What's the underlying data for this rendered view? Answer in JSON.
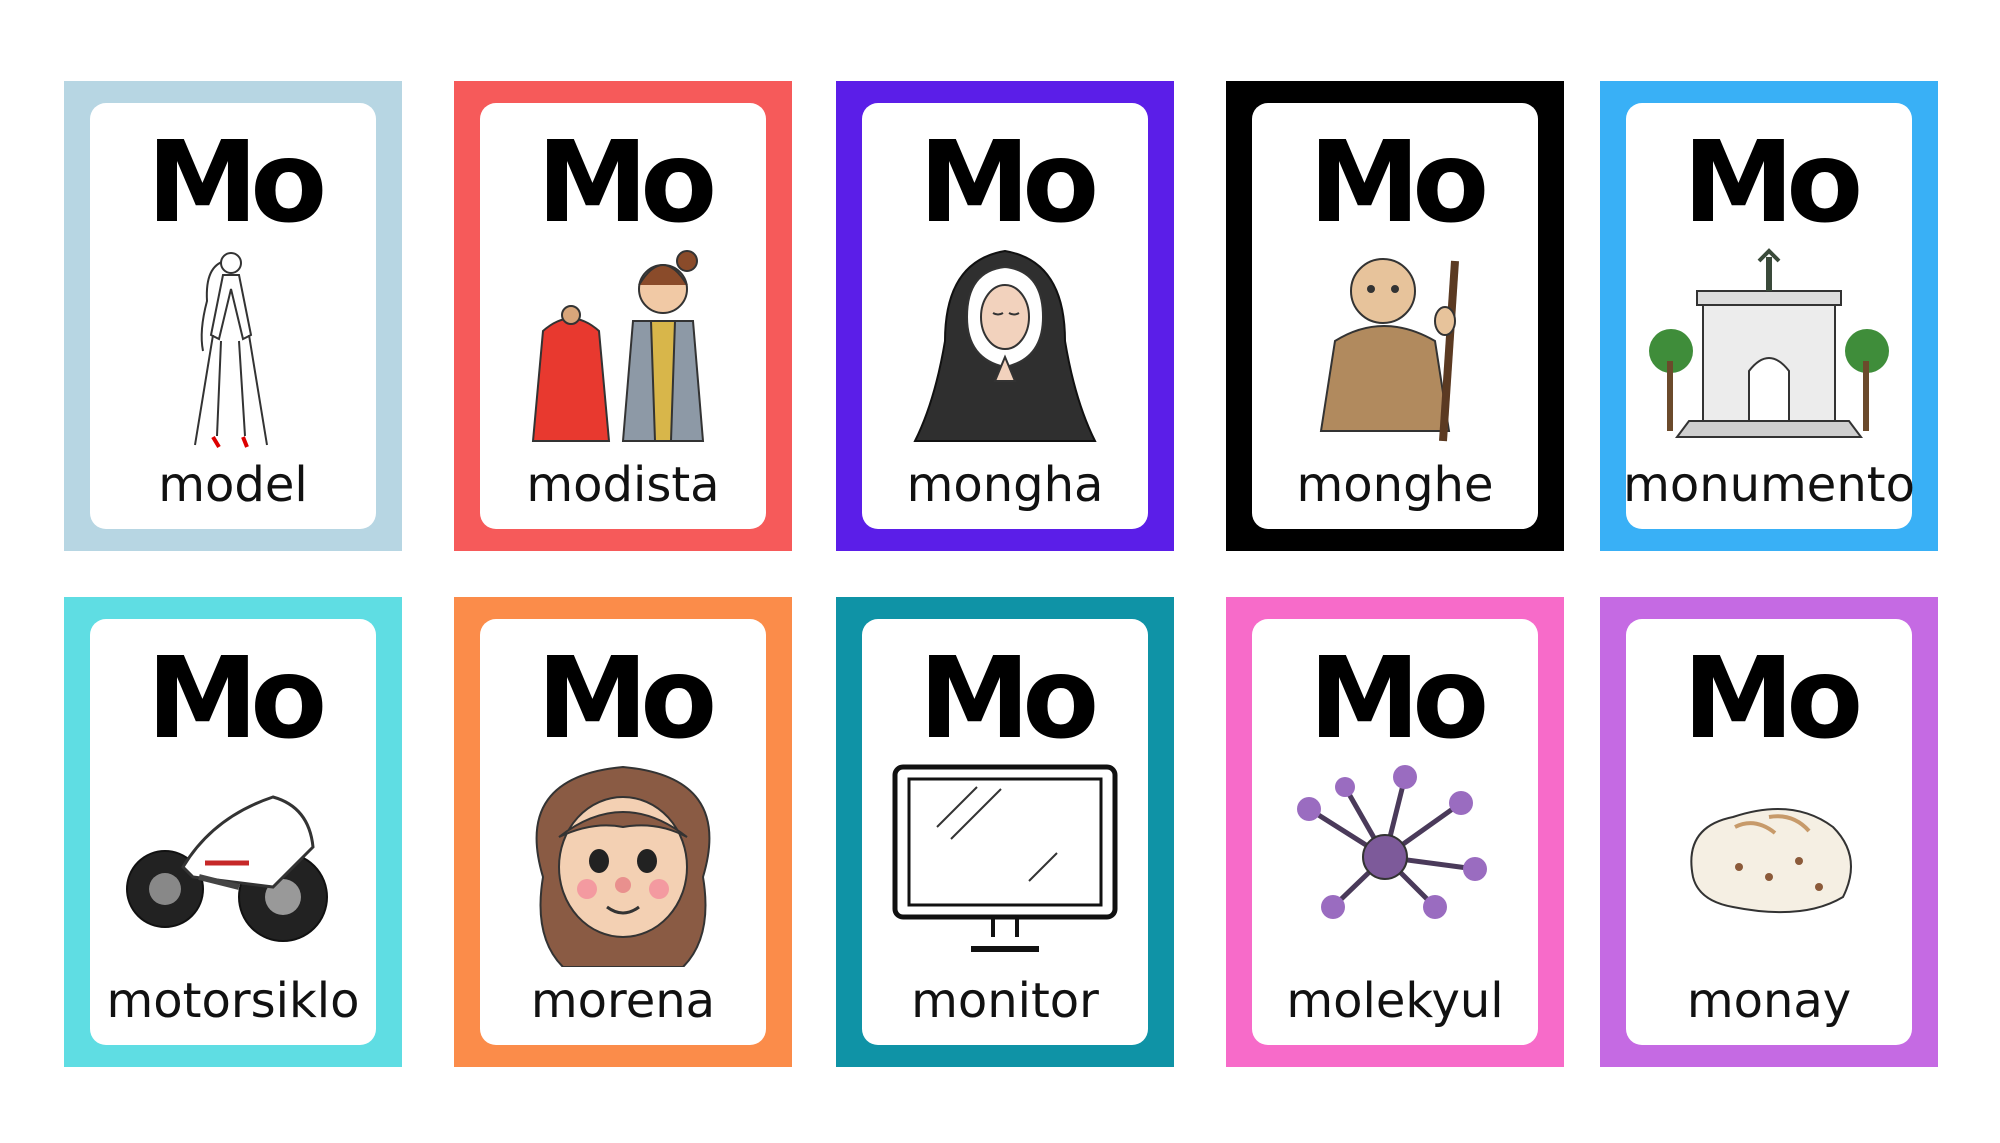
{
  "cards": [
    {
      "syllable": "Mo",
      "word": "model",
      "icon": "fashion-model-icon",
      "frame_color": "#b7d6e3"
    },
    {
      "syllable": "Mo",
      "word": "modista",
      "icon": "dressmaker-icon",
      "frame_color": "#f65a5a"
    },
    {
      "syllable": "Mo",
      "word": "mongha",
      "icon": "nun-icon",
      "frame_color": "#5b1ee8"
    },
    {
      "syllable": "Mo",
      "word": "monghe",
      "icon": "monk-icon",
      "frame_color": "#000000"
    },
    {
      "syllable": "Mo",
      "word": "monumento",
      "icon": "monument-icon",
      "frame_color": "#39b0f6"
    },
    {
      "syllable": "Mo",
      "word": "motorsiklo",
      "icon": "motorcycle-icon",
      "frame_color": "#5fdde3"
    },
    {
      "syllable": "Mo",
      "word": "morena",
      "icon": "girl-face-icon",
      "frame_color": "#fb8c4a"
    },
    {
      "syllable": "Mo",
      "word": "monitor",
      "icon": "monitor-icon",
      "frame_color": "#0f93a6"
    },
    {
      "syllable": "Mo",
      "word": "molekyul",
      "icon": "molecule-icon",
      "frame_color": "#f76bc9"
    },
    {
      "syllable": "Mo",
      "word": "monay",
      "icon": "bread-icon",
      "frame_color": "#c56ae3"
    }
  ]
}
